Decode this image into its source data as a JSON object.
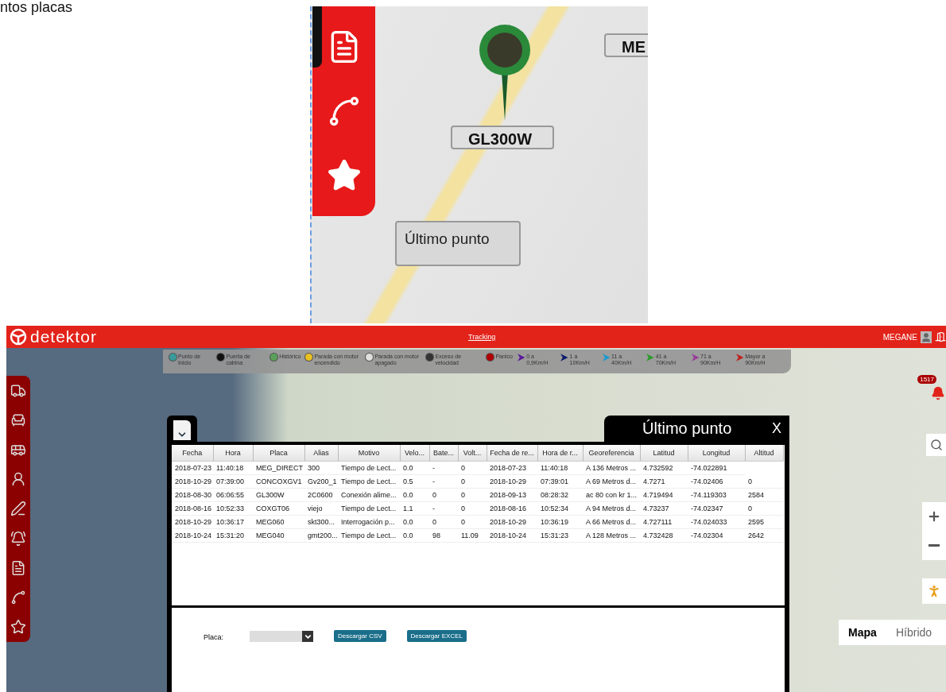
{
  "page_text": "ntos placas",
  "map_zoom": {
    "marker_labels": [
      {
        "label": "GL300W"
      },
      {
        "label": "ME"
      }
    ],
    "tooltip": "Último punto"
  },
  "app": {
    "logo": "detektor",
    "nav_link": "Tracking",
    "user": "MEGANE",
    "legend": [
      {
        "kind": "marker",
        "label": "Punto de Inicio",
        "color": "#3a9a9a"
      },
      {
        "kind": "marker",
        "label": "Puerta de cabina",
        "color": "#111111"
      },
      {
        "kind": "marker",
        "label": "Histórico",
        "color": "#5aa05a"
      },
      {
        "kind": "marker",
        "label": "Parada con motor encendido",
        "color": "#e8c020"
      },
      {
        "kind": "marker",
        "label": "Parada con motor apagado",
        "color": "#e0e0e0"
      },
      {
        "kind": "marker",
        "label": "Exceso de velocidad",
        "color": "#333333"
      },
      {
        "kind": "marker",
        "label": "Panico",
        "color": "#b00000"
      },
      {
        "kind": "arrow",
        "label": "0 a 0,9Km/H",
        "color": "#5a1a9a"
      },
      {
        "kind": "arrow",
        "label": "1 a 10Km/H",
        "color": "#0a1a6a"
      },
      {
        "kind": "arrow",
        "label": "11 a 40Km/H",
        "color": "#1a9ad0"
      },
      {
        "kind": "arrow",
        "label": "41 a 70Km/H",
        "color": "#2a9a2a"
      },
      {
        "kind": "arrow",
        "label": "71 a 90Km/H",
        "color": "#9a3a9a"
      },
      {
        "kind": "arrow",
        "label": "Mayor a 90Km/H",
        "color": "#c02020"
      }
    ],
    "alert_badge": "1517",
    "map_types": [
      {
        "label": "Mapa",
        "selected": true
      },
      {
        "label": "Híbrido",
        "selected": false
      }
    ],
    "dialog": {
      "title": "Último punto",
      "close": "X",
      "columns": [
        "Fecha",
        "Hora",
        "Placa",
        "Alias",
        "Motivo",
        "Velo...",
        "Bate...",
        "Volt...",
        "Fecha de re...",
        "Hora de r...",
        "Georeferencia",
        "Latitud",
        "Longitud",
        "Altitud"
      ],
      "rows": [
        [
          "2018-07-23",
          "11:40:18",
          "MEG_DIRECT",
          "300",
          "Tiempo de Lect...",
          "0.0",
          "-",
          "0",
          "2018-07-23",
          "11:40:18",
          "A 136 Metros ...",
          "4.732592",
          "-74.022891"
        ],
        [
          "2018-10-29",
          "07:39:00",
          "CONCOXGV1",
          "Gv200_1",
          "Tiempo de Lect...",
          "0.5",
          "-",
          "0",
          "2018-10-29",
          "07:39:01",
          "A 69 Metros d...",
          "4.7271",
          "-74.02406",
          "0"
        ],
        [
          "2018-08-30",
          "06:06:55",
          "GL300W",
          "2C0600",
          "Conexión alime...",
          "0.0",
          "0",
          "0",
          "2018-09-13",
          "08:28:32",
          "ac 80 con kr 1...",
          "4.719494",
          "-74.119303",
          "2584"
        ],
        [
          "2018-08-16",
          "10:52:33",
          "COXGT06",
          "viejo",
          "Tiempo de Lect...",
          "1.1",
          "-",
          "0",
          "2018-08-16",
          "10:52:34",
          "A 94 Metros d...",
          "4.73237",
          "-74.02347",
          "0"
        ],
        [
          "2018-10-29",
          "10:36:17",
          "MEG060",
          "skt300...",
          "Interrogación p...",
          "0.0",
          "0",
          "0",
          "2018-10-29",
          "10:36:19",
          "A 66 Metros d...",
          "4.727111",
          "-74.024033",
          "2595"
        ],
        [
          "2018-10-24",
          "15:31:20",
          "MEG040",
          "gmt200...",
          "Tiempo de Lect...",
          "0.0",
          "98",
          "11.09",
          "2018-10-24",
          "15:31:23",
          "A 128 Metros ...",
          "4.732428",
          "-74.02304",
          "2642"
        ]
      ],
      "placa_label": "Placa:",
      "buttons": [
        "Descargar CSV",
        "Descargar EXCEL"
      ]
    }
  }
}
